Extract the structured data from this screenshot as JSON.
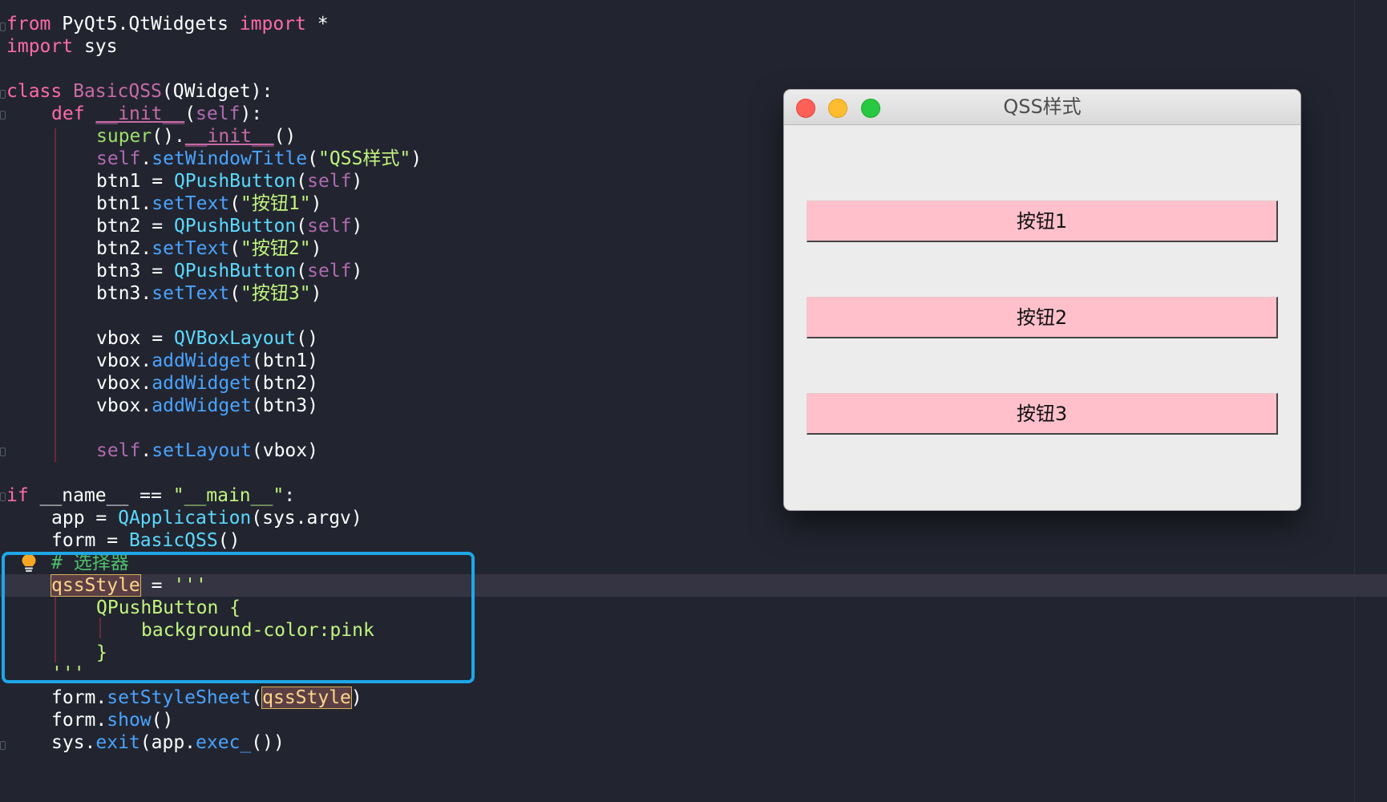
{
  "code": {
    "l1": {
      "kw_from": "from",
      "module": " PyQt5.QtWidgets ",
      "kw_import": "import",
      "star": " *"
    },
    "l2": {
      "kw_import": "import",
      "rest": " sys"
    },
    "l4": {
      "kw_class": "class",
      "cls_name": "BasicQSS",
      "rest": "(QWidget):"
    },
    "l5": {
      "kw_def": "def",
      "dunder": "__init__",
      "open": "(",
      "self": "self",
      "close": "):"
    },
    "l6": {
      "super": "super",
      "mid": "().",
      "dunder": "__init__",
      "end": "()"
    },
    "l7": {
      "self": "self",
      "dot": ".",
      "fn": "setWindowTitle",
      "open": "(",
      "str": "\"QSS样式\"",
      "close": ")"
    },
    "l8": {
      "name": "btn1 = ",
      "cls": "QPushButton",
      "open": "(",
      "self": "self",
      "close": ")"
    },
    "l9": {
      "obj": "btn1.",
      "fn": "setText",
      "open": "(",
      "str": "\"按钮1\"",
      "close": ")"
    },
    "l10": {
      "name": "btn2 = ",
      "cls": "QPushButton",
      "open": "(",
      "self": "self",
      "close": ")"
    },
    "l11": {
      "obj": "btn2.",
      "fn": "setText",
      "open": "(",
      "str": "\"按钮2\"",
      "close": ")"
    },
    "l12": {
      "name": "btn3 = ",
      "cls": "QPushButton",
      "open": "(",
      "self": "self",
      "close": ")"
    },
    "l13": {
      "obj": "btn3.",
      "fn": "setText",
      "open": "(",
      "str": "\"按钮3\"",
      "close": ")"
    },
    "l15": {
      "name": "vbox = ",
      "cls": "QVBoxLayout",
      "rest": "()"
    },
    "l16": {
      "obj": "vbox.",
      "fn": "addWidget",
      "rest": "(btn1)"
    },
    "l17": {
      "obj": "vbox.",
      "fn": "addWidget",
      "rest": "(btn2)"
    },
    "l18": {
      "obj": "vbox.",
      "fn": "addWidget",
      "rest": "(btn3)"
    },
    "l20": {
      "self": "self",
      "dot": ".",
      "fn": "setLayout",
      "rest": "(vbox)"
    },
    "l22": {
      "kw_if": "if",
      "mid": " __name__ == ",
      "str": "\"__main__\"",
      "end": ":"
    },
    "l23": {
      "name": "app = ",
      "cls": "QApplication",
      "rest": "(sys.argv)"
    },
    "l24": {
      "name": "form = ",
      "cls": "BasicQSS",
      "rest": "()"
    },
    "l25": {
      "comment": "# 选择器"
    },
    "l26": {
      "var": "qssStyle",
      "rest": " = ",
      "str": "'''"
    },
    "l27": {
      "str": "QPushButton {"
    },
    "l28": {
      "str": "background-color:pink"
    },
    "l29": {
      "str": "}"
    },
    "l30": {
      "str": "'''"
    },
    "l31": {
      "obj": "form.",
      "fn": "setStyleSheet",
      "open": "(",
      "var": "qssStyle",
      "close": ")"
    },
    "l32": {
      "obj": "form.",
      "fn": "show",
      "rest": "()"
    },
    "l33": {
      "obj": "sys.",
      "fn": "exit",
      "mid": "(app.",
      "fn2": "exec_",
      "rest": "())"
    }
  },
  "window": {
    "title": "QSS样式",
    "buttons": [
      "按钮1",
      "按钮2",
      "按钮3"
    ]
  },
  "colors": {
    "editor_background": "#222530",
    "button_background": "pink",
    "selection_box": "#1ea7e8"
  },
  "icons": [
    "lightbulb-icon",
    "close-window-icon",
    "minimize-window-icon",
    "zoom-window-icon"
  ]
}
